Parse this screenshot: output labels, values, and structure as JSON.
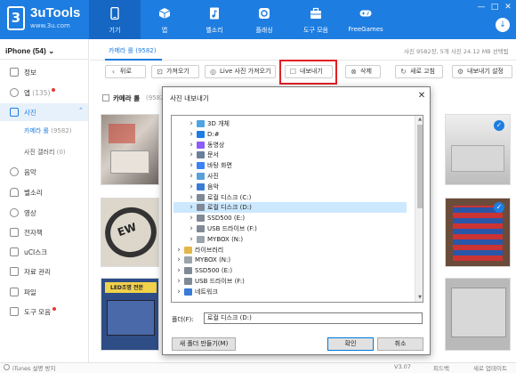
{
  "app": {
    "logo_badge": "3",
    "name": "3uTools",
    "url": "www.3u.com"
  },
  "nav": [
    {
      "label": "기기",
      "icon": "iphone-icon",
      "active": true
    },
    {
      "label": "앱",
      "icon": "box-icon"
    },
    {
      "label": "벨소리",
      "icon": "music-file-icon"
    },
    {
      "label": "플래싱",
      "icon": "flash-gear-icon"
    },
    {
      "label": "도구 모음",
      "icon": "toolbox-icon"
    },
    {
      "label": "FreeGames",
      "icon": "gamepad-icon"
    }
  ],
  "window_controls": {
    "min": "—",
    "max": "□",
    "close": "✕",
    "download": "↓"
  },
  "sidebar": {
    "device": "iPhone (54) ⌄",
    "items": [
      {
        "label": "정보",
        "icon": "info-icon"
      },
      {
        "label": "앱",
        "count": "(135)",
        "icon": "app-icon",
        "dot": true
      },
      {
        "label": "사진",
        "icon": "photo-icon",
        "active": true
      },
      {
        "label": "카메라 롤",
        "count": "(9582)",
        "sub": true,
        "active": true
      },
      {
        "label": "사진 갤러리",
        "count": "(0)",
        "sub": true
      },
      {
        "label": "음악",
        "icon": "music-icon"
      },
      {
        "label": "벨소리",
        "icon": "bell-icon"
      },
      {
        "label": "영상",
        "icon": "video-icon"
      },
      {
        "label": "전자책",
        "icon": "book-icon"
      },
      {
        "label": "uCI스크",
        "icon": "disk-icon"
      },
      {
        "label": "자료 관리",
        "icon": "data-icon"
      },
      {
        "label": "파일",
        "icon": "file-icon"
      },
      {
        "label": "도구 모음",
        "icon": "tool-icon",
        "dot": true
      }
    ]
  },
  "content": {
    "tab_label": "카메라 롤 (9582)",
    "info": "사진 9582장, 5개 사진 24.12 MB 선택됨",
    "toolbar": {
      "back": "뒤로",
      "import": "가져오기",
      "live_import": "Live 사진 가져오기",
      "export": "내보내기",
      "delete": "삭제",
      "refresh": "새로 고침",
      "export_settings": "내보내기 설정"
    },
    "album_title": "카메라 롤",
    "album_count": "(9582)"
  },
  "dialog": {
    "title": "사진 내보내기",
    "close": "✕",
    "tree": [
      {
        "label": "3D 개체",
        "indent": 1,
        "icon": "3d-object-icon"
      },
      {
        "label": "D:#",
        "indent": 1,
        "icon": "download-icon"
      },
      {
        "label": "동영상",
        "indent": 1,
        "icon": "video-folder-icon"
      },
      {
        "label": "문서",
        "indent": 1,
        "icon": "documents-icon"
      },
      {
        "label": "바탕 화면",
        "indent": 1,
        "icon": "desktop-icon"
      },
      {
        "label": "사진",
        "indent": 1,
        "icon": "pictures-icon"
      },
      {
        "label": "음악",
        "indent": 1,
        "icon": "music-folder-icon"
      },
      {
        "label": "로컬 디스크 (C:)",
        "indent": 1,
        "icon": "drive-icon"
      },
      {
        "label": "로컬 디스크 (D:)",
        "indent": 1,
        "icon": "drive-icon",
        "selected": true
      },
      {
        "label": "SSD500 (E:)",
        "indent": 1,
        "icon": "drive-icon"
      },
      {
        "label": "USB 드라이브 (F:)",
        "indent": 1,
        "icon": "usb-drive-icon"
      },
      {
        "label": "MYBOX (N:)",
        "indent": 1,
        "icon": "network-drive-icon"
      },
      {
        "label": "라이브러리",
        "indent": 0,
        "icon": "library-icon"
      },
      {
        "label": "MYBOX (N:)",
        "indent": 0,
        "icon": "network-drive-icon"
      },
      {
        "label": "SSD500 (E:)",
        "indent": 0,
        "icon": "drive-icon"
      },
      {
        "label": "USB 드라이브 (F:)",
        "indent": 0,
        "icon": "usb-drive-icon"
      },
      {
        "label": "네트워크",
        "indent": 0,
        "icon": "network-icon"
      }
    ],
    "folder_label": "폴더(F):",
    "folder_value": "로컬 디스크 (D:)",
    "new_folder": "새 폴더 만들기(M)",
    "ok": "확인",
    "cancel": "취소"
  },
  "status": {
    "left": "iTunes 설명 방지",
    "version": "V3.07",
    "feedback": "피드백",
    "update": "새로 업데이트"
  },
  "colors": {
    "brand": "#1e7de0",
    "highlight": "#e31e24",
    "selection": "#cce8ff"
  }
}
